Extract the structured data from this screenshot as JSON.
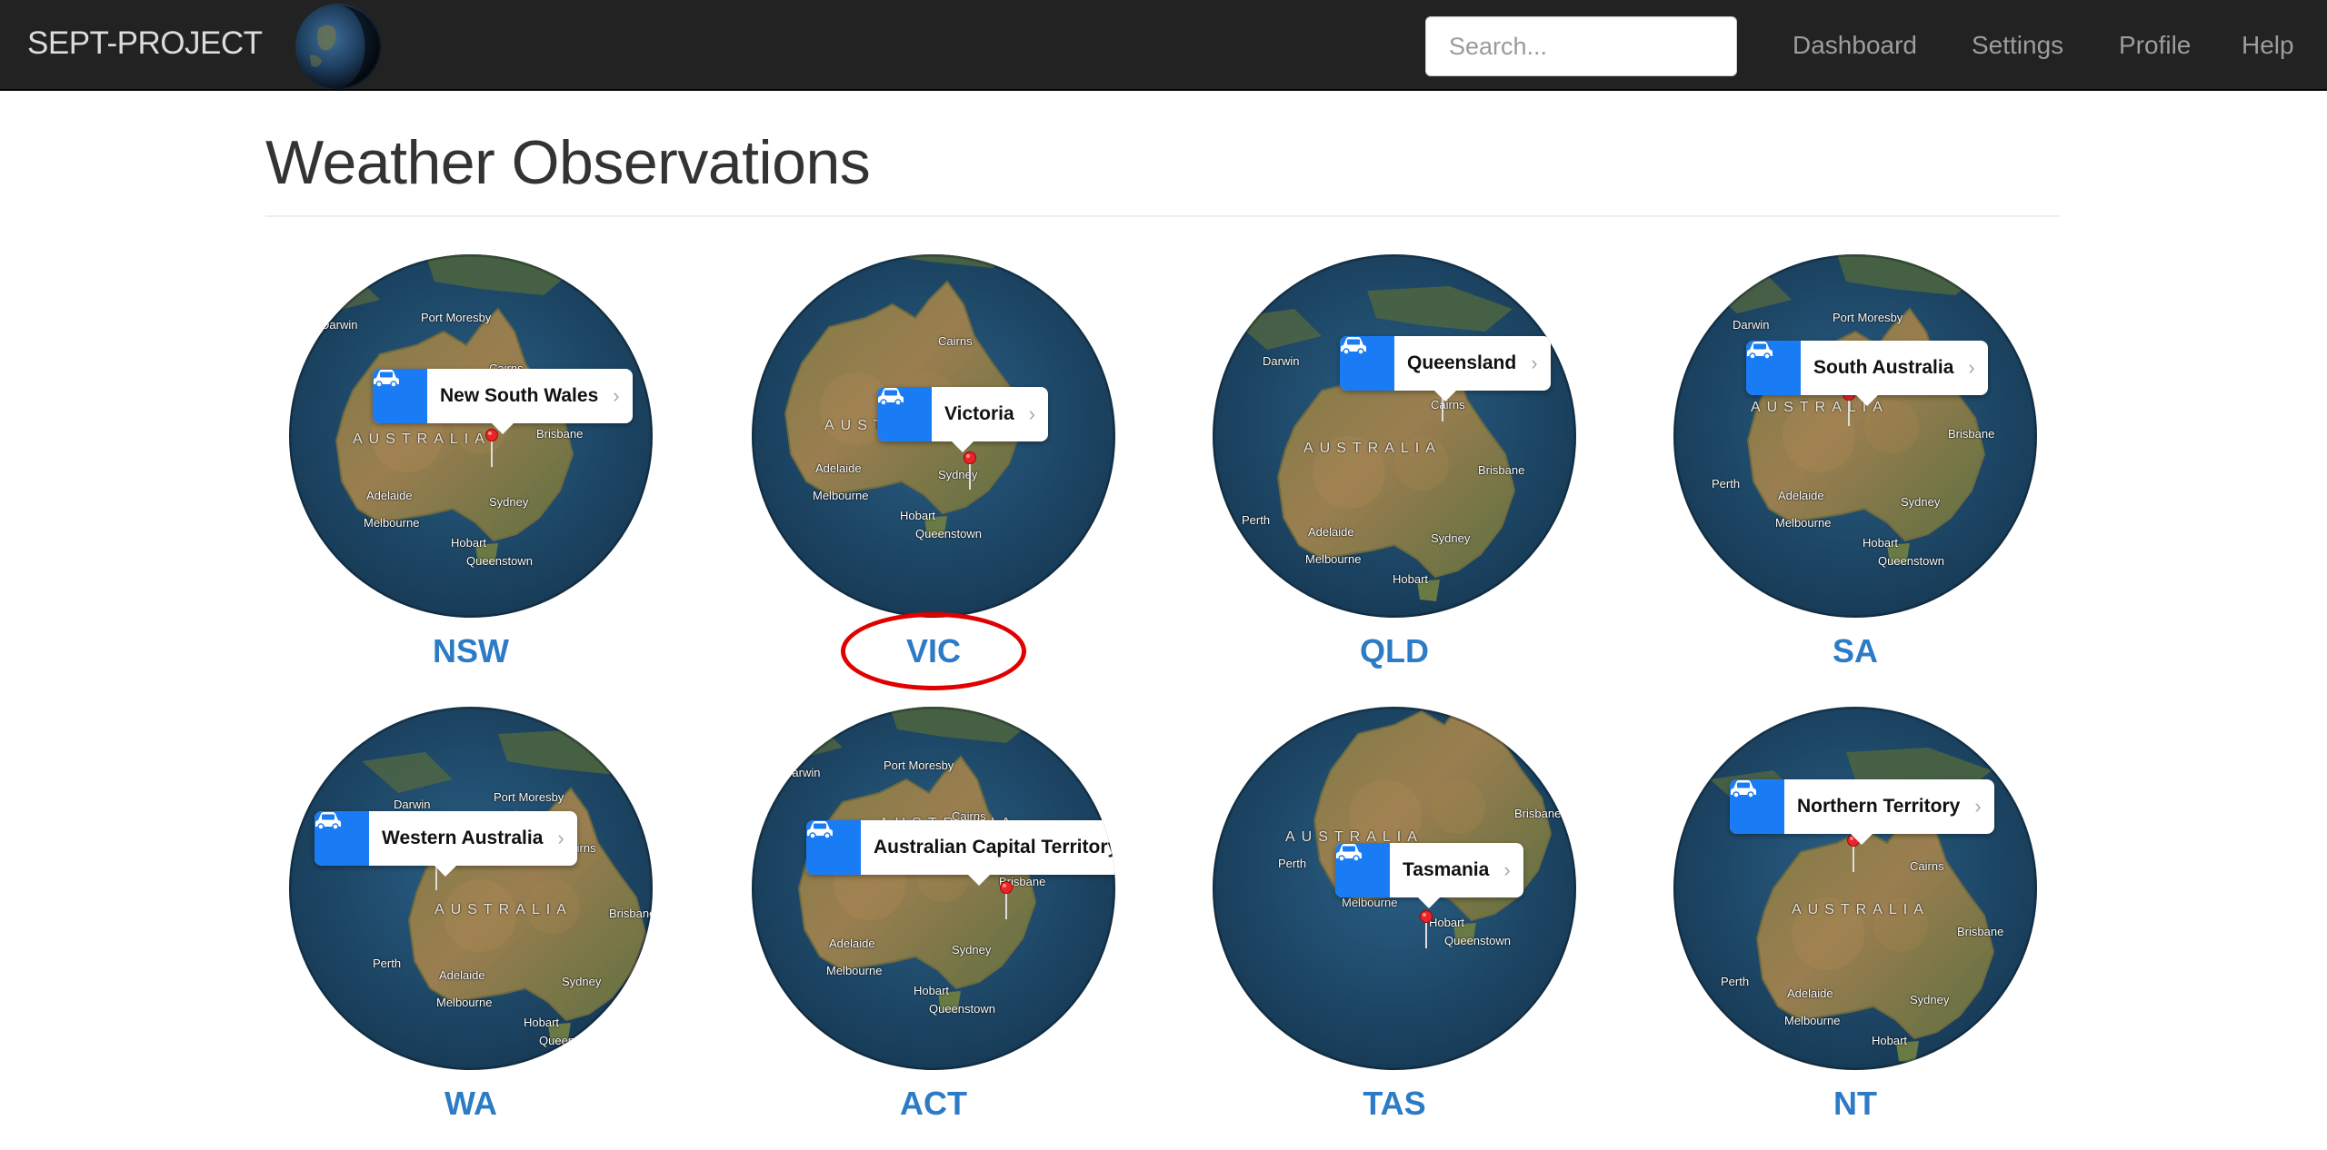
{
  "navbar": {
    "brand": "SEPT-PROJECT",
    "search_placeholder": "Search...",
    "links": [
      "Dashboard",
      "Settings",
      "Profile",
      "Help"
    ]
  },
  "page": {
    "title": "Weather Observations"
  },
  "states": [
    {
      "code": "NSW",
      "callout": "New South Wales"
    },
    {
      "code": "VIC",
      "callout": "Victoria"
    },
    {
      "code": "QLD",
      "callout": "Queensland"
    },
    {
      "code": "SA",
      "callout": "South Australia"
    },
    {
      "code": "WA",
      "callout": "Western Australia"
    },
    {
      "code": "ACT",
      "callout": "Australian Capital Territory"
    },
    {
      "code": "TAS",
      "callout": "Tasmania"
    },
    {
      "code": "NT",
      "callout": "Northern Territory"
    }
  ],
  "map_labels": {
    "country": "AUSTRALIA",
    "cities": [
      "Darwin",
      "Port Moresby",
      "Cairns",
      "Brisbane",
      "Perth",
      "Adelaide",
      "Sydney",
      "Melbourne",
      "Hobart",
      "Queenstown"
    ]
  },
  "highlighted_state": "VIC",
  "colors": {
    "navbar": "#222222",
    "link_blue": "#2b7bc6",
    "callout_blue": "#1a7cf5",
    "highlight_red": "#e00000",
    "ocean": "#1c4a6e",
    "land": "#8a7a4e"
  },
  "icons": {
    "brand": "earth-globe-icon",
    "callout": "car-icon",
    "pin": "map-pin-icon"
  }
}
